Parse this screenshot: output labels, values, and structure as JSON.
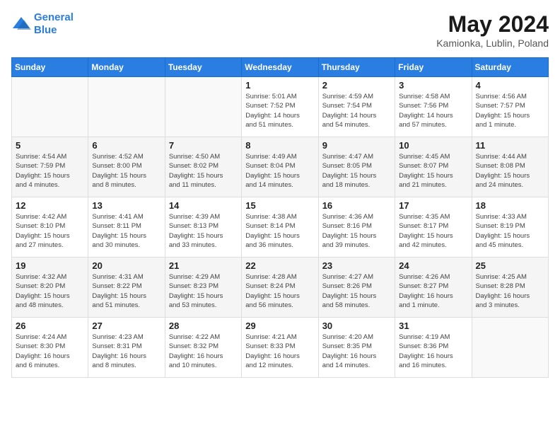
{
  "header": {
    "logo_line1": "General",
    "logo_line2": "Blue",
    "title": "May 2024",
    "subtitle": "Kamionka, Lublin, Poland"
  },
  "days_of_week": [
    "Sunday",
    "Monday",
    "Tuesday",
    "Wednesday",
    "Thursday",
    "Friday",
    "Saturday"
  ],
  "weeks": [
    [
      {
        "day": "",
        "info": ""
      },
      {
        "day": "",
        "info": ""
      },
      {
        "day": "",
        "info": ""
      },
      {
        "day": "1",
        "info": "Sunrise: 5:01 AM\nSunset: 7:52 PM\nDaylight: 14 hours\nand 51 minutes."
      },
      {
        "day": "2",
        "info": "Sunrise: 4:59 AM\nSunset: 7:54 PM\nDaylight: 14 hours\nand 54 minutes."
      },
      {
        "day": "3",
        "info": "Sunrise: 4:58 AM\nSunset: 7:56 PM\nDaylight: 14 hours\nand 57 minutes."
      },
      {
        "day": "4",
        "info": "Sunrise: 4:56 AM\nSunset: 7:57 PM\nDaylight: 15 hours\nand 1 minute."
      }
    ],
    [
      {
        "day": "5",
        "info": "Sunrise: 4:54 AM\nSunset: 7:59 PM\nDaylight: 15 hours\nand 4 minutes."
      },
      {
        "day": "6",
        "info": "Sunrise: 4:52 AM\nSunset: 8:00 PM\nDaylight: 15 hours\nand 8 minutes."
      },
      {
        "day": "7",
        "info": "Sunrise: 4:50 AM\nSunset: 8:02 PM\nDaylight: 15 hours\nand 11 minutes."
      },
      {
        "day": "8",
        "info": "Sunrise: 4:49 AM\nSunset: 8:04 PM\nDaylight: 15 hours\nand 14 minutes."
      },
      {
        "day": "9",
        "info": "Sunrise: 4:47 AM\nSunset: 8:05 PM\nDaylight: 15 hours\nand 18 minutes."
      },
      {
        "day": "10",
        "info": "Sunrise: 4:45 AM\nSunset: 8:07 PM\nDaylight: 15 hours\nand 21 minutes."
      },
      {
        "day": "11",
        "info": "Sunrise: 4:44 AM\nSunset: 8:08 PM\nDaylight: 15 hours\nand 24 minutes."
      }
    ],
    [
      {
        "day": "12",
        "info": "Sunrise: 4:42 AM\nSunset: 8:10 PM\nDaylight: 15 hours\nand 27 minutes."
      },
      {
        "day": "13",
        "info": "Sunrise: 4:41 AM\nSunset: 8:11 PM\nDaylight: 15 hours\nand 30 minutes."
      },
      {
        "day": "14",
        "info": "Sunrise: 4:39 AM\nSunset: 8:13 PM\nDaylight: 15 hours\nand 33 minutes."
      },
      {
        "day": "15",
        "info": "Sunrise: 4:38 AM\nSunset: 8:14 PM\nDaylight: 15 hours\nand 36 minutes."
      },
      {
        "day": "16",
        "info": "Sunrise: 4:36 AM\nSunset: 8:16 PM\nDaylight: 15 hours\nand 39 minutes."
      },
      {
        "day": "17",
        "info": "Sunrise: 4:35 AM\nSunset: 8:17 PM\nDaylight: 15 hours\nand 42 minutes."
      },
      {
        "day": "18",
        "info": "Sunrise: 4:33 AM\nSunset: 8:19 PM\nDaylight: 15 hours\nand 45 minutes."
      }
    ],
    [
      {
        "day": "19",
        "info": "Sunrise: 4:32 AM\nSunset: 8:20 PM\nDaylight: 15 hours\nand 48 minutes."
      },
      {
        "day": "20",
        "info": "Sunrise: 4:31 AM\nSunset: 8:22 PM\nDaylight: 15 hours\nand 51 minutes."
      },
      {
        "day": "21",
        "info": "Sunrise: 4:29 AM\nSunset: 8:23 PM\nDaylight: 15 hours\nand 53 minutes."
      },
      {
        "day": "22",
        "info": "Sunrise: 4:28 AM\nSunset: 8:24 PM\nDaylight: 15 hours\nand 56 minutes."
      },
      {
        "day": "23",
        "info": "Sunrise: 4:27 AM\nSunset: 8:26 PM\nDaylight: 15 hours\nand 58 minutes."
      },
      {
        "day": "24",
        "info": "Sunrise: 4:26 AM\nSunset: 8:27 PM\nDaylight: 16 hours\nand 1 minute."
      },
      {
        "day": "25",
        "info": "Sunrise: 4:25 AM\nSunset: 8:28 PM\nDaylight: 16 hours\nand 3 minutes."
      }
    ],
    [
      {
        "day": "26",
        "info": "Sunrise: 4:24 AM\nSunset: 8:30 PM\nDaylight: 16 hours\nand 6 minutes."
      },
      {
        "day": "27",
        "info": "Sunrise: 4:23 AM\nSunset: 8:31 PM\nDaylight: 16 hours\nand 8 minutes."
      },
      {
        "day": "28",
        "info": "Sunrise: 4:22 AM\nSunset: 8:32 PM\nDaylight: 16 hours\nand 10 minutes."
      },
      {
        "day": "29",
        "info": "Sunrise: 4:21 AM\nSunset: 8:33 PM\nDaylight: 16 hours\nand 12 minutes."
      },
      {
        "day": "30",
        "info": "Sunrise: 4:20 AM\nSunset: 8:35 PM\nDaylight: 16 hours\nand 14 minutes."
      },
      {
        "day": "31",
        "info": "Sunrise: 4:19 AM\nSunset: 8:36 PM\nDaylight: 16 hours\nand 16 minutes."
      },
      {
        "day": "",
        "info": ""
      }
    ]
  ]
}
